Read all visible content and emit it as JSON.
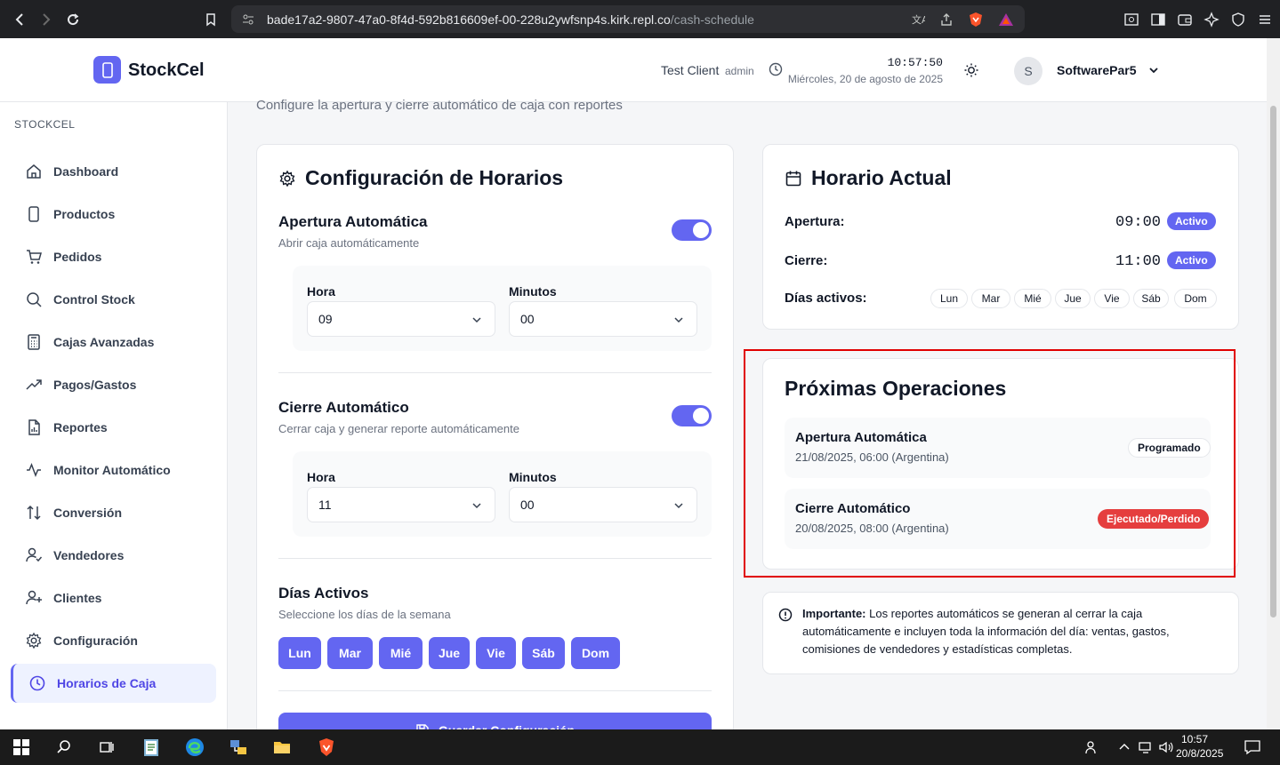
{
  "browser": {
    "url_host": "bade17a2-9807-47a0-8f4d-592b816609ef-00-228u2ywfsnp4s.kirk.repl.co",
    "url_path": "/cash-schedule"
  },
  "header": {
    "app_name": "StockCel",
    "client_name": "Test Client",
    "client_role": "admin",
    "time": "10:57:50",
    "date": "Miércoles, 20 de agosto de 2025",
    "avatar_letter": "S",
    "user_name": "SoftwarePar5"
  },
  "sidebar": {
    "section_label": "STOCKCEL",
    "items": [
      {
        "label": "Dashboard"
      },
      {
        "label": "Productos"
      },
      {
        "label": "Pedidos"
      },
      {
        "label": "Control Stock"
      },
      {
        "label": "Cajas Avanzadas"
      },
      {
        "label": "Pagos/Gastos"
      },
      {
        "label": "Reportes"
      },
      {
        "label": "Monitor Automático"
      },
      {
        "label": "Conversión"
      },
      {
        "label": "Vendedores"
      },
      {
        "label": "Clientes"
      },
      {
        "label": "Configuración"
      },
      {
        "label": "Horarios de Caja"
      }
    ]
  },
  "page": {
    "subtitle": "Configure la apertura y cierre automático de caja con reportes"
  },
  "config": {
    "title": "Configuración de Horarios",
    "opening": {
      "title": "Apertura Automática",
      "subtitle": "Abrir caja automáticamente",
      "enabled": true,
      "hour_label": "Hora",
      "hour_value": "09",
      "minutes_label": "Minutos",
      "minutes_value": "00"
    },
    "closing": {
      "title": "Cierre Automático",
      "subtitle": "Cerrar caja y generar reporte automáticamente",
      "enabled": true,
      "hour_label": "Hora",
      "hour_value": "11",
      "minutes_label": "Minutos",
      "minutes_value": "00"
    },
    "days": {
      "title": "Días Activos",
      "subtitle": "Seleccione los días de la semana",
      "items": [
        "Lun",
        "Mar",
        "Mié",
        "Jue",
        "Vie",
        "Sáb",
        "Dom"
      ]
    },
    "save_label": "Guardar Configuración"
  },
  "current": {
    "title": "Horario Actual",
    "opening_label": "Apertura:",
    "opening_time": "09:00",
    "opening_status": "Activo",
    "closing_label": "Cierre:",
    "closing_time": "11:00",
    "closing_status": "Activo",
    "days_label": "Días activos:",
    "days": [
      "Lun",
      "Mar",
      "Mié",
      "Jue",
      "Vie",
      "Sáb",
      "Dom"
    ]
  },
  "upcoming": {
    "title": "Próximas Operaciones",
    "items": [
      {
        "title": "Apertura Automática",
        "date": "21/08/2025, 06:00 (Argentina)",
        "status": "Programado"
      },
      {
        "title": "Cierre Automático",
        "date": "20/08/2025, 08:00 (Argentina)",
        "status": "Ejecutado/Perdido"
      }
    ]
  },
  "info": {
    "bold": "Importante:",
    "text": " Los reportes automáticos se generan al cerrar la caja automáticamente e incluyen toda la información del día: ventas, gastos, comisiones de vendedores y estadísticas completas."
  },
  "taskbar": {
    "time": "10:57",
    "date": "20/8/2025"
  },
  "colors": {
    "accent": "#6366f1",
    "danger": "#e53e3e",
    "highlight_border": "#e00000"
  }
}
